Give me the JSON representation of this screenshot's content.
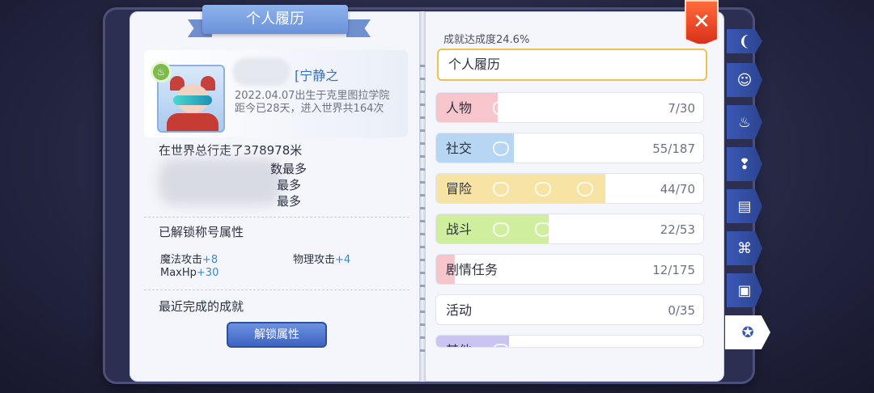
{
  "header": {
    "title": "个人履历"
  },
  "profile": {
    "name_tag": "[宁静之",
    "birth_line": "2022.04.07出生于克里图拉学院",
    "days_line": "距今已28天，进入世界共164次",
    "badge_icon": "chef-hat-icon"
  },
  "stats": {
    "walked": "在世界总行走了378978米",
    "tail_lines": [
      "数最多",
      "最多",
      "最多"
    ]
  },
  "title_attrs": {
    "heading": "已解锁称号属性",
    "items": [
      {
        "name": "魔法攻击",
        "bonus": "+8"
      },
      {
        "name": "物理攻击",
        "bonus": "+4"
      },
      {
        "name": "MaxHp",
        "bonus": "+30"
      }
    ]
  },
  "recent": {
    "heading": "最近完成的成就"
  },
  "unlock_button": {
    "label": "解锁属性"
  },
  "achievement": {
    "progress_label": "成就达成度24.6%",
    "current_category": "个人履历",
    "categories": [
      {
        "label": "人物",
        "count": "7/30",
        "progress": 0.23,
        "color": "#f7c6cc"
      },
      {
        "label": "社交",
        "count": "55/187",
        "progress": 0.29,
        "color": "#b6d6f4"
      },
      {
        "label": "冒险",
        "count": "44/70",
        "progress": 0.63,
        "color": "#f7e3a3"
      },
      {
        "label": "战斗",
        "count": "22/53",
        "progress": 0.42,
        "color": "#cfee9e"
      },
      {
        "label": "剧情任务",
        "count": "12/175",
        "progress": 0.07,
        "color": "#f7c6cc"
      },
      {
        "label": "活动",
        "count": "0/35",
        "progress": 0.0,
        "color": "#eeeeee"
      },
      {
        "label": "其他",
        "count": "",
        "progress": 0.27,
        "color": "#c9c4f2"
      }
    ]
  },
  "close_button": {
    "icon": "close-icon",
    "glyph": "✕"
  },
  "side_tabs": [
    {
      "icon": "wing-icon",
      "glyph": "❨"
    },
    {
      "icon": "face-icon",
      "glyph": "☺"
    },
    {
      "icon": "chef-hat-icon",
      "glyph": "♨"
    },
    {
      "icon": "idea-icon",
      "glyph": "❢"
    },
    {
      "icon": "book-icon",
      "glyph": "▤"
    },
    {
      "icon": "card-icon",
      "glyph": "⌘"
    },
    {
      "icon": "briefcase-icon",
      "glyph": "▣"
    },
    {
      "icon": "medal-icon",
      "glyph": "✪"
    }
  ]
}
